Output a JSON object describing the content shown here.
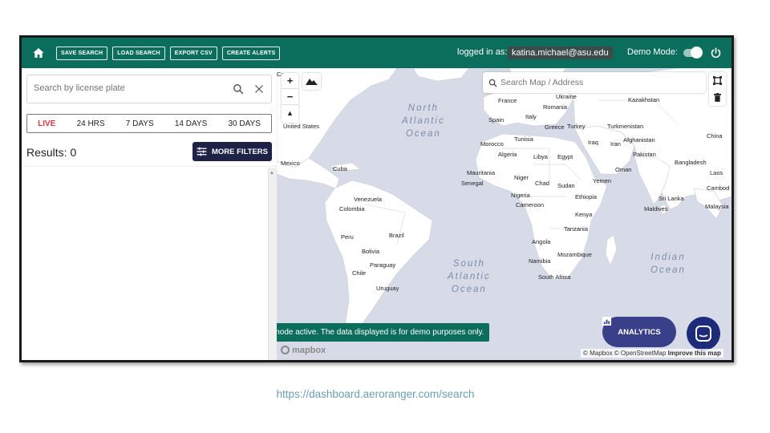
{
  "topbar": {
    "home_icon": "home-icon",
    "buttons": [
      "SAVE SEARCH",
      "LOAD SEARCH",
      "EXPORT CSV",
      "CREATE ALERTS"
    ],
    "logged_in_label": "logged in as:",
    "user_email": "katina.michael@asu.edu",
    "demo_mode_label": "Demo Mode:",
    "demo_mode_on": true,
    "power_icon": "power-icon"
  },
  "sidebar": {
    "search_placeholder": "Search by license plate",
    "time_filters": [
      "LIVE",
      "24 HRS",
      "7 DAYS",
      "14 DAYS",
      "30 DAYS"
    ],
    "results_text": "Results: 0",
    "more_filters_label": "MORE FILTERS"
  },
  "map": {
    "search_placeholder": "Search Map / Address",
    "zoom_in": "+",
    "zoom_out": "−",
    "compass": "▲",
    "countries": [
      "France",
      "Ukraine",
      "Kazakhstan",
      "Romania",
      "Spain",
      "Italy",
      "Greece",
      "Turkey",
      "Turkmenistan",
      "China",
      "Morocco",
      "Tunisia",
      "Iraq",
      "Iran",
      "Afghanistan",
      "Algeria",
      "Libya",
      "Egypt",
      "Pakistan",
      "Mauritania",
      "Niger",
      "Oman",
      "Bangladesh",
      "Laos",
      "Senegal",
      "Chad",
      "Sudan",
      "Yemen",
      "Cambod",
      "Nigeria",
      "Ethiopia",
      "Sri Lanka",
      "Cameroon",
      "Maldives",
      "Malaysia",
      "Kenya",
      "Tanzania",
      "Angola",
      "Mozambique",
      "Namibia",
      "South Africa",
      "United States",
      "Mexico",
      "Cuba",
      "Venezuela",
      "Colombia",
      "Peru",
      "Brazil",
      "Bolivia",
      "Paraguay",
      "Chile",
      "Uruguay",
      "Car"
    ],
    "oceans": [
      {
        "lines": [
          "North",
          "Atlantic",
          "Ocean"
        ]
      },
      {
        "lines": [
          "South",
          "Atlantic",
          "Ocean"
        ]
      },
      {
        "lines": [
          "Indian",
          "Ocean"
        ]
      }
    ],
    "demo_notice": "Demo mode active. The data displayed is for demo purposes only.",
    "analytics_label": "ANALYTICS",
    "mapbox_logo": "mapbox",
    "attribution": "© Mapbox © OpenStreetMap",
    "improve_link": "Improve this map"
  },
  "caption": {
    "url": "https://dashboard.aeroranger.com/search"
  },
  "colors": {
    "topbar": "#0b6e5c",
    "accent_dark": "#1e2246",
    "live": "#d9363e",
    "analytics": "#3a3f8a",
    "ocean": "#d7dbe8",
    "land": "#ffffff"
  }
}
